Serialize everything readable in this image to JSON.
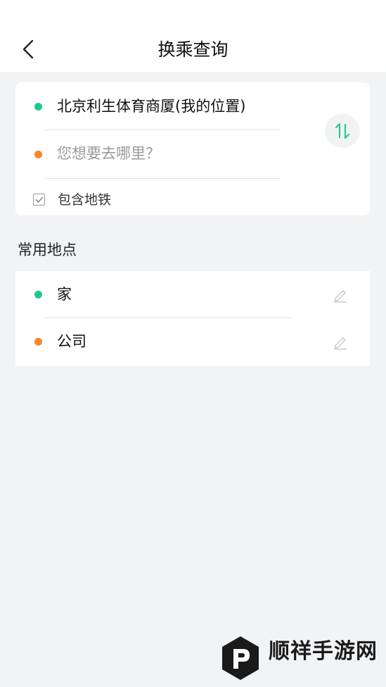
{
  "header": {
    "title": "换乘查询",
    "back_icon": "chevron-left-icon"
  },
  "route": {
    "origin": "北京利生体育商厦(我的位置)",
    "destination_placeholder": "您想要去哪里？",
    "swap_icon": "swap-vertical-icon",
    "include_subway_label": "包含地铁",
    "include_subway_checked": true
  },
  "common_places": {
    "title": "常用地点",
    "items": [
      {
        "label": "家",
        "dot_color": "#1ec98f",
        "edit_icon": "pencil-icon"
      },
      {
        "label": "公司",
        "dot_color": "#f7852a",
        "edit_icon": "pencil-icon"
      }
    ]
  },
  "watermark": {
    "text": "顺祥手游网",
    "logo_icon": "p-logo-icon"
  },
  "colors": {
    "accent_green": "#1ec98f",
    "accent_orange": "#f7852a",
    "background": "#f2f3f5"
  }
}
